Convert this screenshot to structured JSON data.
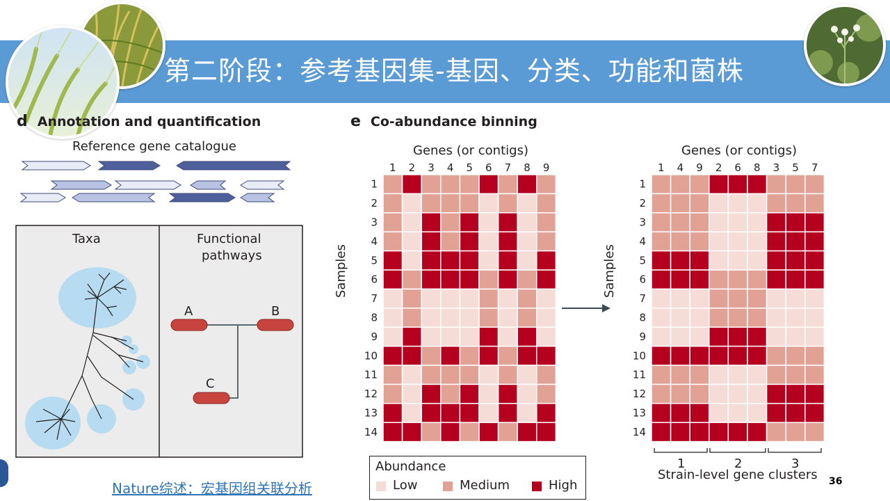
{
  "slide": {
    "title": "第二阶段：参考基因集-基因、分类、功能和菌株",
    "link_text": "Nature综述：宏基因组关联分析",
    "page_number": "36"
  },
  "panel_d": {
    "letter": "d",
    "heading": "Annotation and quantification",
    "catalogue_label": "Reference gene catalogue",
    "taxa_label": "Taxa",
    "pathways_label": "Functional pathways",
    "pathways_line1": "Functional",
    "pathways_line2": "pathways",
    "node_a": "A",
    "node_b": "B",
    "node_c": "C"
  },
  "panel_e": {
    "letter": "e",
    "heading": "Co-abundance binning",
    "genes_label": "Genes (or contigs)",
    "samples_label": "Samples",
    "left_columns": [
      "1",
      "2",
      "3",
      "4",
      "5",
      "6",
      "7",
      "8",
      "9"
    ],
    "right_columns": [
      "1",
      "4",
      "9",
      "2",
      "6",
      "8",
      "3",
      "5",
      "7"
    ],
    "rows": [
      "1",
      "2",
      "3",
      "4",
      "5",
      "6",
      "7",
      "8",
      "9",
      "10",
      "11",
      "12",
      "13",
      "14"
    ],
    "left_matrix": [
      [
        1,
        2,
        1,
        1,
        1,
        2,
        1,
        2,
        1
      ],
      [
        1,
        0,
        1,
        1,
        1,
        0,
        1,
        0,
        1
      ],
      [
        1,
        0,
        2,
        1,
        2,
        0,
        2,
        0,
        1
      ],
      [
        1,
        0,
        2,
        1,
        2,
        0,
        2,
        0,
        1
      ],
      [
        2,
        0,
        2,
        2,
        2,
        0,
        2,
        0,
        2
      ],
      [
        2,
        1,
        2,
        2,
        2,
        1,
        2,
        1,
        2
      ],
      [
        0,
        1,
        0,
        0,
        0,
        1,
        0,
        1,
        0
      ],
      [
        0,
        1,
        0,
        0,
        0,
        1,
        0,
        1,
        0
      ],
      [
        0,
        2,
        0,
        0,
        0,
        2,
        0,
        2,
        0
      ],
      [
        2,
        2,
        1,
        2,
        1,
        2,
        1,
        2,
        2
      ],
      [
        1,
        0,
        1,
        1,
        1,
        0,
        1,
        0,
        1
      ],
      [
        1,
        0,
        2,
        1,
        2,
        0,
        2,
        0,
        1
      ],
      [
        2,
        0,
        2,
        2,
        2,
        0,
        2,
        0,
        2
      ],
      [
        2,
        2,
        1,
        2,
        1,
        2,
        1,
        2,
        2
      ]
    ],
    "right_matrix": [
      [
        1,
        1,
        1,
        2,
        2,
        2,
        1,
        1,
        1
      ],
      [
        1,
        1,
        1,
        0,
        0,
        0,
        1,
        1,
        1
      ],
      [
        1,
        1,
        1,
        0,
        0,
        0,
        2,
        2,
        2
      ],
      [
        1,
        1,
        1,
        0,
        0,
        0,
        2,
        2,
        2
      ],
      [
        2,
        2,
        2,
        0,
        0,
        0,
        2,
        2,
        2
      ],
      [
        2,
        2,
        2,
        1,
        1,
        1,
        2,
        2,
        2
      ],
      [
        0,
        0,
        0,
        1,
        1,
        1,
        0,
        0,
        0
      ],
      [
        0,
        0,
        0,
        1,
        1,
        1,
        0,
        0,
        0
      ],
      [
        0,
        0,
        0,
        2,
        2,
        2,
        0,
        0,
        0
      ],
      [
        2,
        2,
        2,
        2,
        2,
        2,
        1,
        1,
        1
      ],
      [
        1,
        1,
        1,
        0,
        0,
        0,
        1,
        1,
        1
      ],
      [
        1,
        1,
        1,
        0,
        0,
        0,
        2,
        2,
        2
      ],
      [
        2,
        2,
        2,
        0,
        0,
        0,
        2,
        2,
        2
      ],
      [
        2,
        2,
        2,
        2,
        2,
        2,
        1,
        1,
        1
      ]
    ],
    "cluster_labels": [
      "1",
      "2",
      "3"
    ],
    "clusters_caption": "Strain-level gene clusters",
    "legend": {
      "title": "Abundance",
      "low": "Low",
      "medium": "Medium",
      "high": "High"
    },
    "colors": {
      "low": "#f6dcd6",
      "medium": "#e1a195",
      "high": "#b5001f",
      "grid": "#ffffff"
    }
  },
  "colors": {
    "banner": "#5b9bd5",
    "link": "#2e75b6",
    "node": "#c8453f",
    "bubble": "#b7dcf1",
    "panel_bg": "#ececec"
  }
}
